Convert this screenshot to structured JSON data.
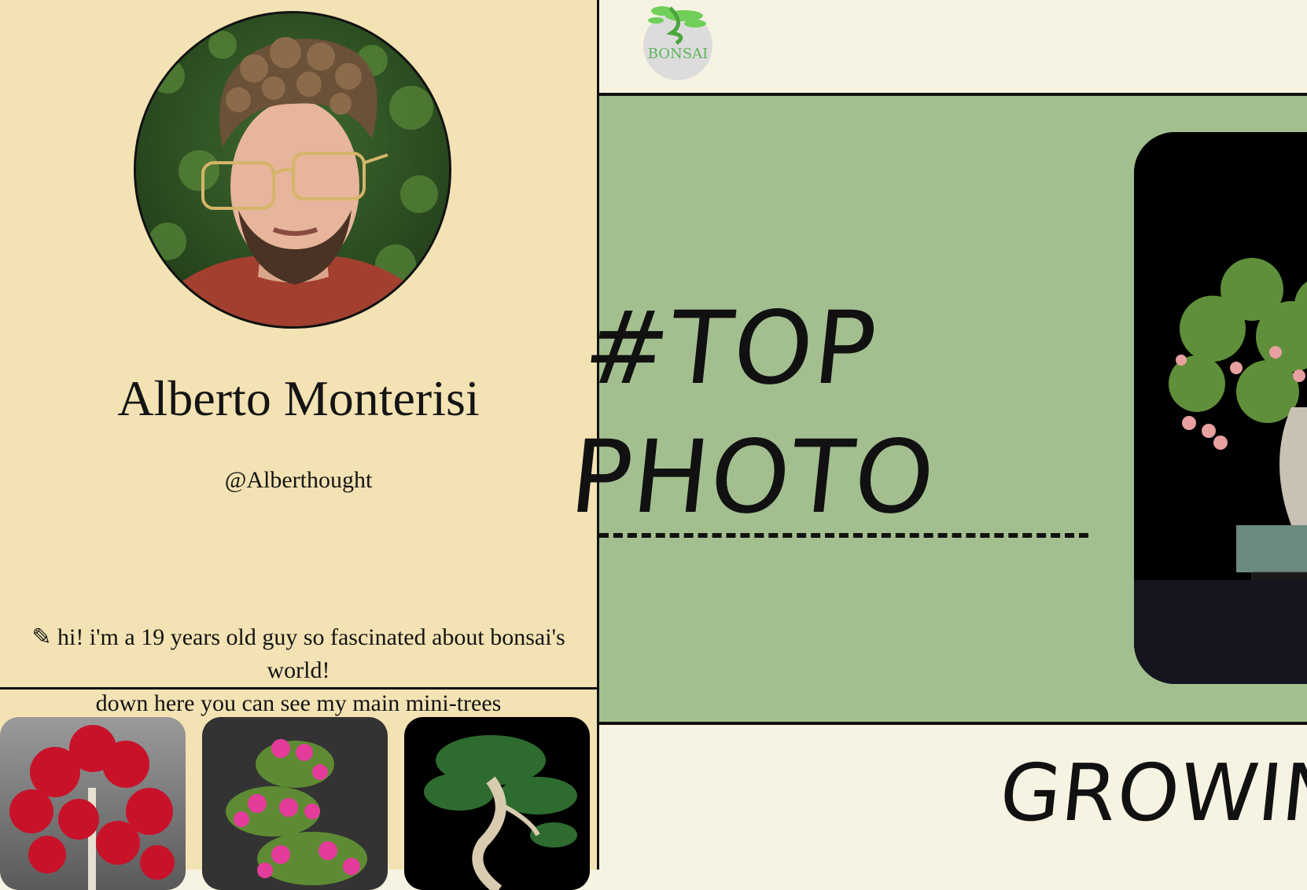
{
  "profile": {
    "name": "Alberto Monterisi",
    "handle": "@Alberthought",
    "bio_line1": "✎ hi! i'm a 19 years old guy so fascinated about bonsai's world!",
    "bio_line2": "down here you can see my main mini-trees"
  },
  "header": {
    "logo_text": "BONSAI"
  },
  "hero": {
    "title_line1": "#TOP",
    "title_line2": "PHOTO"
  },
  "section": {
    "title": "GROWING"
  },
  "colors": {
    "left_bg": "#f3e2b3",
    "hero_bg": "#a3bf8f",
    "page_bg": "#f7f3e3",
    "logo_green": "#5fb55b"
  }
}
